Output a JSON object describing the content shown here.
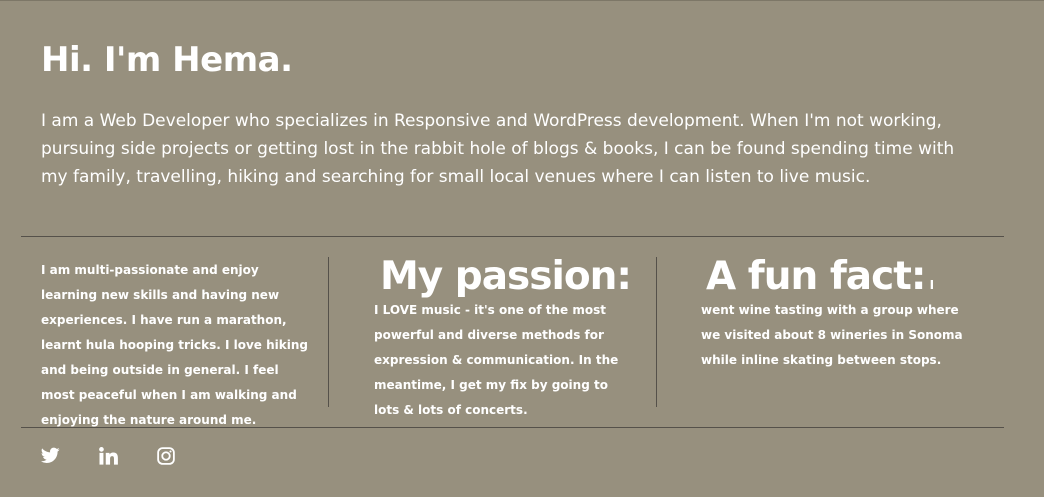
{
  "intro": {
    "heading": "Hi. I'm Hema.",
    "text": "I am a Web Developer who specializes in Responsive and WordPress development. When I'm not working, pursuing side projects or getting lost in the rabbit hole of blogs & books, I can be found spending time with my family, travelling, hiking and searching for small local venues where I can listen to live music."
  },
  "columns": {
    "about": {
      "text": "I am multi-passionate and enjoy learning new skills and having new experiences. I have run a marathon, learnt hula hooping tricks. I love hiking and being outside in general. I feel most peaceful when I am walking and enjoying the nature around me."
    },
    "passion": {
      "heading": "My passion:",
      "text": "I LOVE music - it's one of the most powerful and diverse methods for expression & communication. In the meantime, I get my fix by going to lots & lots of concerts."
    },
    "fun_fact": {
      "heading": "A fun fact:",
      "text": "I went wine tasting with a group where we visited about 8 wineries in Sonoma while inline skating between stops."
    }
  },
  "social": {
    "icons": [
      "twitter-icon",
      "linkedin-icon",
      "instagram-icon"
    ]
  },
  "colors": {
    "background": "#97907e",
    "text": "#ffffff",
    "divider": "#55514a"
  }
}
